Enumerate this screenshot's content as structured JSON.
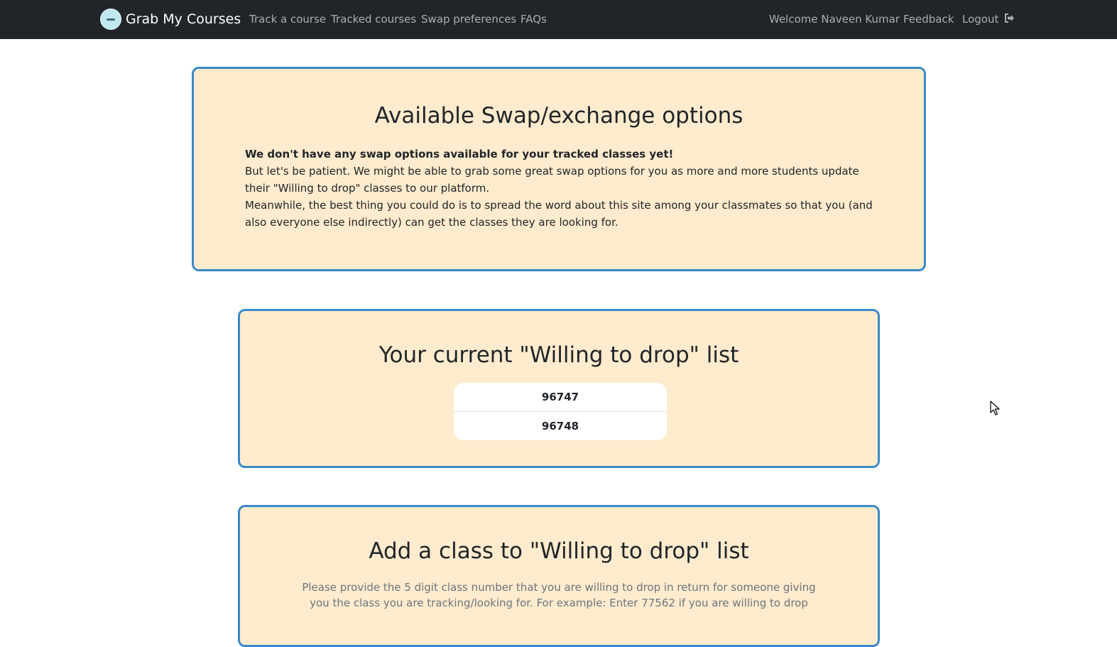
{
  "navbar": {
    "brand": "Grab My Courses",
    "links": [
      "Track a course",
      "Tracked courses",
      "Swap preferences",
      "FAQs"
    ],
    "welcome": "Welcome Naveen Kumar",
    "feedback": "Feedback",
    "logout": "Logout",
    "logout_icon": "sign-out-icon",
    "background": "#212529"
  },
  "swap_options": {
    "title": "Available Swap/exchange options",
    "bold_line": "We don't have any swap options available for your tracked classes yet!",
    "para1": "But let's be patient. We might be able to grab some great swap options for you as more and more students update their \"Willing to drop\" classes to our platform.",
    "para2": "Meanwhile, the best thing you could do is to spread the word about this site among your classmates so that you (and also everyone else indirectly) can get the classes they are looking for."
  },
  "willing_to_drop": {
    "title": "Your current \"Willing to drop\" list",
    "items": [
      "96747",
      "96748"
    ]
  },
  "add_class": {
    "title": "Add a class to \"Willing to drop\" list",
    "description": "Please provide the 5 digit class number that you are willing to drop in return for someone giving you the class you are tracking/looking for. For example: Enter 77562 if you are willing to drop"
  },
  "colors": {
    "card_background": "#ffebcd",
    "card_border": "#3a89c9"
  }
}
